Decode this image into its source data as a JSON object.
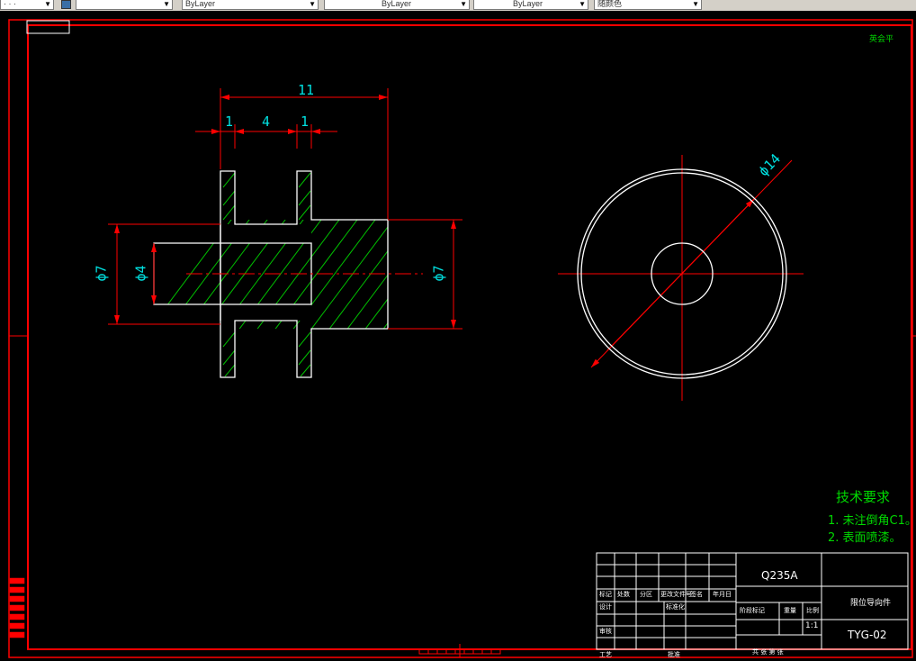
{
  "toolbar": {
    "combo1": "· · ·",
    "combo2": "ByLayer",
    "combo3": "ByLayer",
    "combo4": "ByLayer",
    "combo5": "随颜色"
  },
  "dimensions": {
    "overall_length": "11",
    "left_flange": "1",
    "groove": "4",
    "right_flange": "1",
    "dia_left": "ϕ7",
    "dia_bore": "ϕ4",
    "dia_right": "ϕ7",
    "dia_outer": "ϕ14"
  },
  "stamp": "英会平",
  "tech_req": {
    "title": "技术要求",
    "line1": "1. 未注倒角C1。",
    "line2": "2. 表面喷漆。"
  },
  "title_block": {
    "material": "Q235A",
    "part_name": "限位导向件",
    "drawing_no": "TYG-02",
    "scale": "1:1",
    "labels": {
      "mark": "标记",
      "count": "处数",
      "zone": "分区",
      "change_doc": "更改文件号",
      "sign": "签名",
      "date": "年月日",
      "design": "设计",
      "standardize": "标准化",
      "stage_mark": "阶段标记",
      "weight": "重量",
      "scale_label": "比例",
      "review": "审核",
      "process": "工艺",
      "approve": "批准",
      "sheets": "共  张  第  张"
    }
  },
  "colors": {
    "border": "#ff0000",
    "geometry": "#ffffff",
    "hatch": "#00c000",
    "dim_text": "#00e0e0",
    "tech_text": "#00d800"
  }
}
